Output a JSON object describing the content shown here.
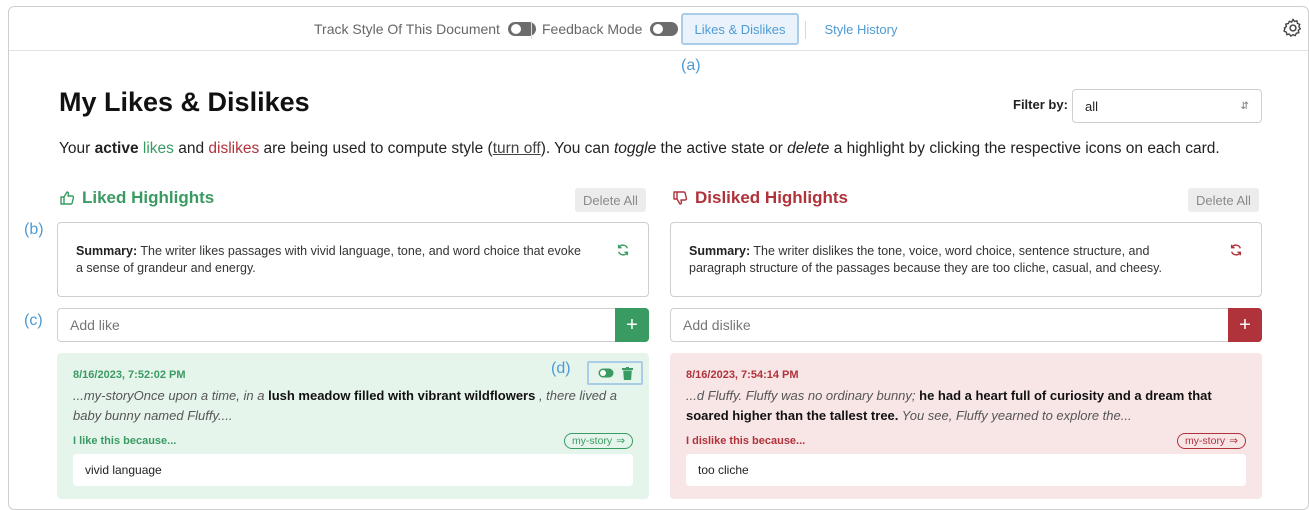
{
  "topbar": {
    "track_style_label": "Track Style Of This Document",
    "feedback_mode_label": "Feedback Mode",
    "tab_likes": "Likes & Dislikes",
    "tab_history": "Style History"
  },
  "annotations": {
    "a": "(a)",
    "b": "(b)",
    "c": "(c)",
    "d": "(d)"
  },
  "page": {
    "title": "My Likes & Dislikes",
    "filter_label": "Filter by:",
    "filter_value": "all",
    "desc": {
      "part1": "Your ",
      "active": "active",
      "likes": "likes",
      "and": " and ",
      "dislikes": "dislikes",
      "part2": " are being used to compute style (",
      "turn_off": "turn off",
      "part3": "). You can ",
      "toggle": "toggle",
      "part4": " the active state or ",
      "delete": "delete",
      "part5": " a highlight by clicking the respective icons on each card."
    }
  },
  "liked": {
    "heading": "Liked Highlights",
    "delete_all": "Delete All",
    "summary_label": "Summary:",
    "summary_text": " The writer likes passages with vivid language, tone, and word choice that evoke a sense of grandeur and energy.",
    "add_placeholder": "Add like",
    "add_button": "+",
    "card": {
      "timestamp": "8/16/2023, 7:52:02 PM",
      "passage_pre": "...my-storyOnce upon a time, in a ",
      "passage_bold": "lush meadow filled with vibrant wildflowers",
      "passage_post": " , there lived a baby bunny named Fluffy....",
      "because": "I like this because...",
      "tag": "my-story",
      "reason": "vivid language"
    }
  },
  "disliked": {
    "heading": "Disliked Highlights",
    "delete_all": "Delete All",
    "summary_label": "Summary:",
    "summary_text": " The writer dislikes the tone, voice, word choice, sentence structure, and paragraph structure of the passages because they are too cliche, casual, and cheesy.",
    "add_placeholder": "Add dislike",
    "add_button": "+",
    "card": {
      "timestamp": "8/16/2023, 7:54:14 PM",
      "passage_pre": "...d Fluffy. Fluffy was no ordinary bunny; ",
      "passage_bold": "he had a heart full of curiosity and a dream that soared higher than the tallest tree.",
      "passage_post": " You see, Fluffy yearned to explore the...",
      "because": "I dislike this because...",
      "tag": "my-story",
      "reason": "too cliche"
    }
  },
  "colors": {
    "like": "#3a9b62",
    "dislike": "#b0323a",
    "accent": "#4e9bd4"
  }
}
